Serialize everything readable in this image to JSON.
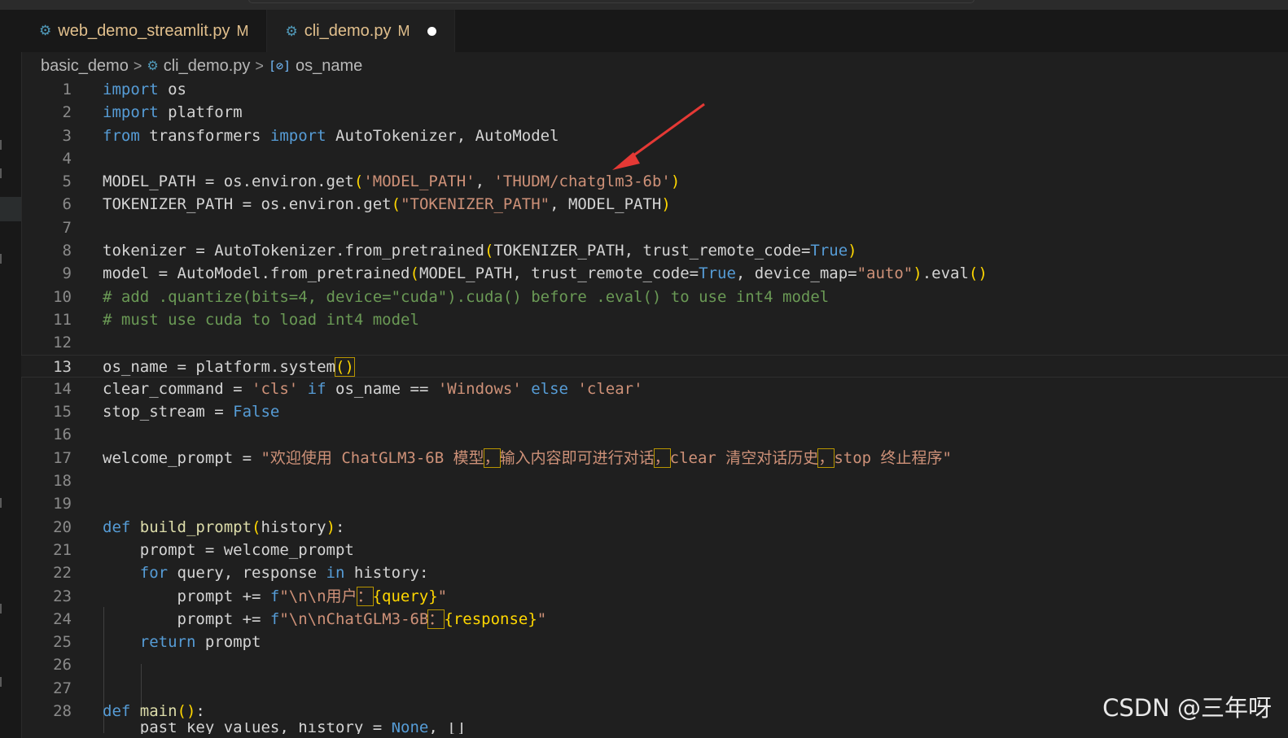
{
  "tabs": [
    {
      "filename": "web_demo_streamlit.py",
      "status": "M",
      "active": false
    },
    {
      "filename": "cli_demo.py",
      "status": "M",
      "active": true,
      "unsaved": true
    }
  ],
  "breadcrumb": {
    "folder": "basic_demo",
    "file": "cli_demo.py",
    "symbol": "os_name",
    "symbol_icon": "[⊘]"
  },
  "code": {
    "line_numbers": [
      "1",
      "2",
      "3",
      "4",
      "5",
      "6",
      "7",
      "8",
      "9",
      "10",
      "11",
      "12",
      "13",
      "14",
      "15",
      "16",
      "17",
      "18",
      "19",
      "20",
      "21",
      "22",
      "23",
      "24",
      "25",
      "26",
      "27",
      "28"
    ],
    "current_line": "13",
    "l1": {
      "kw": "import",
      "rest": " os"
    },
    "l2": {
      "kw": "import",
      "rest": " platform"
    },
    "l3": {
      "kw1": "from",
      "mod": " transformers ",
      "kw2": "import",
      "rest": " AutoTokenizer, AutoModel"
    },
    "l5": {
      "a": "MODEL_PATH = os.environ.get",
      "s1": "'MODEL_PATH'",
      "c": ", ",
      "s2": "'THUDM/chatglm3-6b'"
    },
    "l6": {
      "a": "TOKENIZER_PATH = os.environ.get",
      "s1": "\"TOKENIZER_PATH\"",
      "c": ", MODEL_PATH"
    },
    "l8": {
      "a": "tokenizer = AutoTokenizer.from_pretrained",
      "b": "TOKENIZER_PATH, trust_remote_code=",
      "t": "True"
    },
    "l9": {
      "a": "model = AutoModel.from_pretrained",
      "b": "MODEL_PATH, trust_remote_code=",
      "t": "True",
      "c": ", device_map=",
      "s": "\"auto\"",
      "d": ".eval"
    },
    "l10": "# add .quantize(bits=4, device=\"cuda\").cuda() before .eval() to use int4 model",
    "l11": "# must use cuda to load int4 model",
    "l13": {
      "a": "os_name = platform.system"
    },
    "l14": {
      "a": "clear_command = ",
      "s1": "'cls'",
      "k1": " if ",
      "b": "os_name == ",
      "s2": "'Windows'",
      "k2": " else ",
      "s3": "'clear'"
    },
    "l15": {
      "a": "stop_stream = ",
      "k": "False"
    },
    "l17": {
      "a": "welcome_prompt = ",
      "s1": "\"欢迎使用 ChatGLM3-6B 模型",
      "s2": "输入内容即可进行对话",
      "s3": "clear 清空对话历史",
      "s4": "stop 终止程序\"",
      "p": "，"
    },
    "l20": {
      "k": "def ",
      "f": "build_prompt",
      "arg": "history",
      "end": ":"
    },
    "l21": {
      "a": "    prompt = welcome_prompt"
    },
    "l22": {
      "k1": "    for",
      "a": " query, response ",
      "k2": "in",
      "b": " history:"
    },
    "l23": {
      "a": "        prompt += ",
      "f": "f",
      "s1": "\"\\n\\n用户",
      "p": "：",
      "v": "{query}",
      "s2": "\""
    },
    "l24": {
      "a": "        prompt += ",
      "f": "f",
      "s1": "\"\\n\\nChatGLM3-6B",
      "p": "：",
      "v": "{response}",
      "s2": "\""
    },
    "l25": {
      "k": "    return",
      "a": " prompt"
    },
    "l28": {
      "k": "def ",
      "f": "main",
      "end": ":"
    },
    "l29": {
      "a": "    past_key_values, history = ",
      "k": "None",
      "c": ", []"
    }
  },
  "watermark": "CSDN @三年呀",
  "colors": {
    "keyword": "#569cd6",
    "string": "#ce9178",
    "comment": "#6a9955",
    "annotation_arrow": "#e53935"
  }
}
